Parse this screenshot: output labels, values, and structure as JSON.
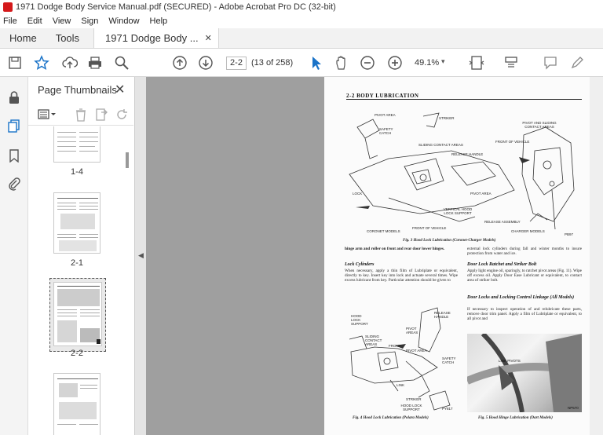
{
  "window": {
    "title": "1971 Dodge Body Service Manual.pdf (SECURED) - Adobe Acrobat Pro DC (32-bit)"
  },
  "menu": [
    "File",
    "Edit",
    "View",
    "Sign",
    "Window",
    "Help"
  ],
  "tabs": {
    "home": "Home",
    "tools": "Tools",
    "document": "1971 Dodge Body ...",
    "close_glyph": "✕"
  },
  "toolbar": {
    "page_value": "2-2",
    "page_count": "(13 of 258)",
    "zoom_value": "49.1%",
    "icons": [
      "save-icon",
      "bookmark-star-icon",
      "upload-icon",
      "print-icon",
      "search-icon",
      "page-up-icon",
      "page-down-icon",
      "select-arrow-icon",
      "hand-icon",
      "zoom-out-icon",
      "zoom-in-icon",
      "fit-page-icon",
      "scroll-mode-icon",
      "comment-icon",
      "pen-icon"
    ]
  },
  "thumbnails_panel": {
    "title": "Page Thumbnails",
    "close_glyph": "✕",
    "labels": [
      "1-4",
      "2-1",
      "2-2"
    ]
  },
  "document": {
    "heading": "2-2 BODY LUBRICATION",
    "fig3_caption": "Fig. 3 Hood Lock Lubrication (Coronet-Charger Models)",
    "fig3_labels": {
      "pivot_area": "PIVOT AREA",
      "striker": "STRIKER",
      "safety_catch": "SAFETY CATCH",
      "sliding_contact": "SLIDING CONTACT AREAS",
      "release_handle": "RELEASE HANDLE",
      "lock": "LOCK",
      "pivot_area2": "PIVOT AREA",
      "vertical_hood": "VERTICAL HOOD LOCK SUPPORT",
      "coronet_models": "CORONET MODELS",
      "front_of_vehicle": "FRONT OF VEHICLE",
      "pivot_sliding": "PIVOT AND SLIDING CONTACT AREAS",
      "front_of_vehicle2": "FRONT OF VEHICLE",
      "release_assembly": "RELEASE ASSEMBLY",
      "charger_models": "CHARGER MODELS",
      "pb": "PB97"
    },
    "para_hinge": "hinge arm and roller on front and rear door lower hinges.",
    "lock_cyl_head": "Lock Cylinders",
    "lock_cyl_text": "When necessary, apply a thin film of Lubriplate or equivalent, directly to key. Insert key into lock and actuate several times. Wipe excess lubricant from key. Particular attention should be given to",
    "right_para1": "external lock cylinders during fall and winter months to insure protection from water and ice.",
    "ratchet_head": "Door Lock Ratchet and Striker Bolt",
    "ratchet_text": "Apply light engine oil, sparingly, to ratchet pivot areas (Fig. 11). Wipe off excess oil. Apply Door Ease Lubricant or equivalent, to contact area of striker bolt.",
    "linkage_head": "Door Locks and Locking Control Linkage (All Models)",
    "linkage_text": "If necessary to inspect operation of and relubricate these parts, remove door trim panel. Apply a film of Lubriplate or equivalent, to all pivot and",
    "fig4_labels": {
      "release_handle": "RELEASE HANDLE",
      "hood_lock_support": "HOOD LOCK SUPPORT",
      "pivot_areas": "PIVOT AREAS",
      "sliding_contact": "SLIDING CONTACT AREAS",
      "front": "FRONT",
      "pivot_area": "PIVOT AREA",
      "safety_catch": "SAFETY CATCH",
      "link": "LINK",
      "striker": "STRIKER",
      "hood_lock_support2": "HOOD LOCK SUPPORT",
      "py": "PY817"
    },
    "fig4_caption": "Fig. 4 Hood Lock Lubrication (Polara Models)",
    "fig5_label": "LINK PIVOTS",
    "fig5_num": "NP570",
    "fig5_caption": "Fig. 5 Hood Hinge Lubrication (Dart Models)"
  }
}
